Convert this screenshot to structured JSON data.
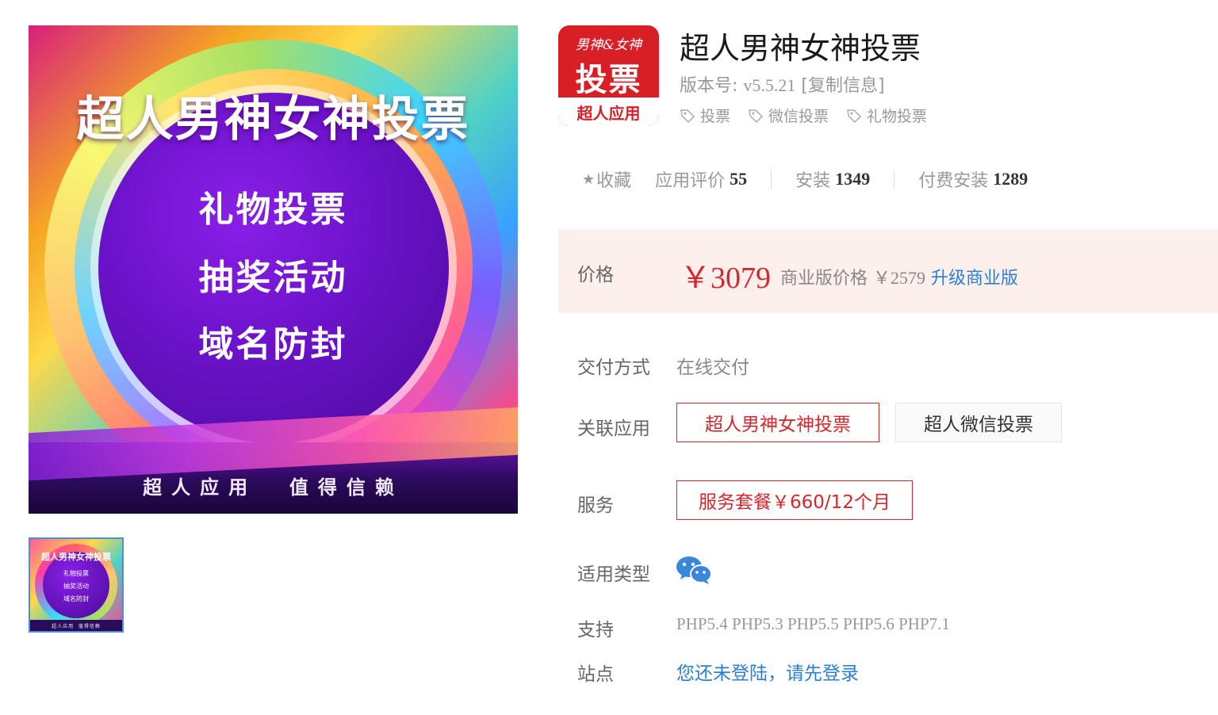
{
  "hero": {
    "title": "超人男神女神投票",
    "lines": [
      "礼物投票",
      "抽奖活动",
      "域名防封"
    ],
    "slogan": "超人应用  值得信赖"
  },
  "thumbnail": {
    "title": "超人男神女神投票",
    "lines": [
      "礼物投票",
      "抽奖活动",
      "域名防封"
    ],
    "slogan": "超人应用  值得信赖"
  },
  "app_icon": {
    "top_text": "男神&女神",
    "main_text": "投票",
    "bottom_text": "超人应用",
    "color": "#d91f26"
  },
  "product": {
    "title": "超人男神女神投票",
    "version_label": "版本号:",
    "version": "v5.5.21",
    "copy_link": "[复制信息]",
    "tags": [
      "投票",
      "微信投票",
      "礼物投票"
    ]
  },
  "stats": {
    "favorite_label": "收藏",
    "rating_label": "应用评价",
    "rating_value": "55",
    "install_label": "安装",
    "install_value": "1349",
    "paid_install_label": "付费安装",
    "paid_install_value": "1289"
  },
  "price": {
    "label": "价格",
    "value": "￥3079",
    "commercial_label": "商业版价格",
    "commercial_value": "￥2579",
    "upgrade_link": "升级商业版"
  },
  "details": {
    "delivery_label": "交付方式",
    "delivery_value": "在线交付",
    "related_label": "关联应用",
    "related_apps": [
      "超人男神女神投票",
      "超人微信投票"
    ],
    "service_label": "服务",
    "service_value": "服务套餐￥660/12个月",
    "type_label": "适用类型",
    "type_icon": "wechat-icon",
    "support_label": "支持",
    "support_value": "PHP5.4 PHP5.3 PHP5.5 PHP5.6 PHP7.1",
    "site_label": "站点",
    "site_value": "您还未登陆，请先登录"
  },
  "colors": {
    "accent_red": "#d9262c",
    "link_blue": "#2a7fd4",
    "price_bg": "#fdefec"
  }
}
